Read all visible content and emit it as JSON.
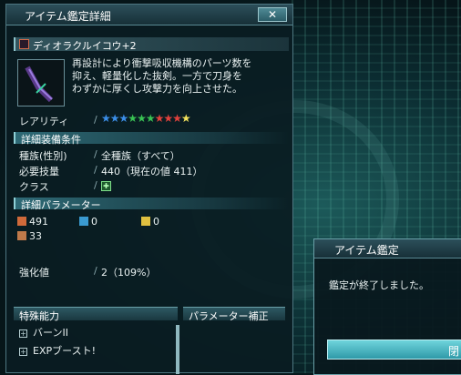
{
  "window": {
    "title": "アイテム鑑定詳細",
    "close_label": "✕"
  },
  "item": {
    "name": "ディオラクルイコウ+2",
    "description": [
      "再設計により衝撃吸収機構のパーツ数を",
      "抑え、軽量化した抜剣。一方で刀身を",
      "わずかに厚くし攻撃力を向上させた。"
    ],
    "rarity_label": "レアリティ",
    "rarity": 10,
    "stars": [
      {
        "color": "#3b8ee8"
      },
      {
        "color": "#3b8ee8"
      },
      {
        "color": "#3b8ee8"
      },
      {
        "color": "#39c254"
      },
      {
        "color": "#39c254"
      },
      {
        "color": "#39c254"
      },
      {
        "color": "#e0413c"
      },
      {
        "color": "#e0413c"
      },
      {
        "color": "#e0413c"
      },
      {
        "color": "#f2e25c"
      }
    ]
  },
  "requirements": {
    "header": "詳細装備条件",
    "race_label": "種族(性別)",
    "race_value": "全種族（すべて）",
    "skill_label": "必要技量",
    "skill_value": "440（現在の値 411）",
    "class_label": "クラス",
    "class_icon": "class-icon"
  },
  "parameters": {
    "header": "詳細パラメーター",
    "attack_melee": "491",
    "attack_ranged": "0",
    "attack_tech": "0",
    "dexterity": "33"
  },
  "enhance": {
    "label": "強化値",
    "value": "2（109%）"
  },
  "abilities": {
    "header": "特殊能力",
    "items": [
      "バーンII",
      "EXPブースト!"
    ]
  },
  "param_bonus": {
    "header": "パラメーター補正"
  },
  "dialog": {
    "title": "アイテム鑑定",
    "message": "鑑定が終了しました。",
    "button_label": "閉"
  },
  "colors": {
    "accent": "#8fd0d6",
    "window_bg": "#0a1c22"
  }
}
